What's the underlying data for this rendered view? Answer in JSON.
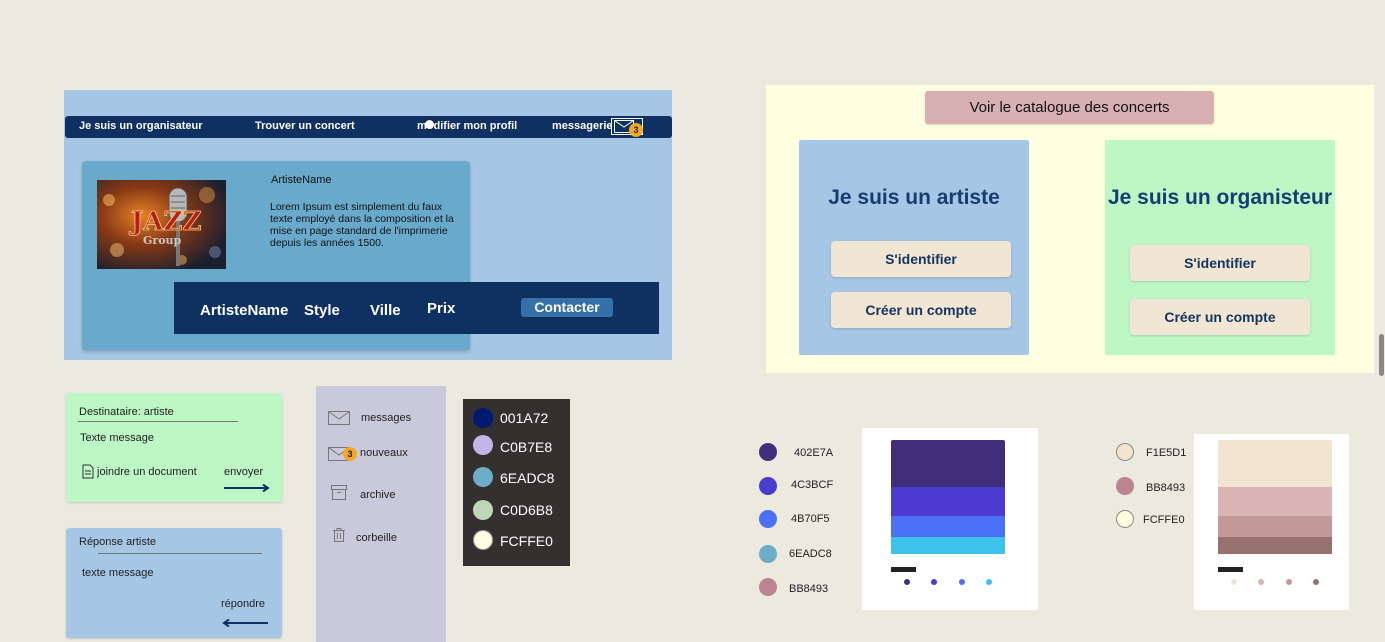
{
  "nav": {
    "organizer": "Je suis un organisateur",
    "find_concert": "Trouver un concert",
    "edit_profile": "modifier mon profil",
    "messaging": "messagerie",
    "badge_count": "3"
  },
  "artist_card": {
    "name": "ArtisteName",
    "description": "Lorem Ipsum est simplement du faux texte employé dans la  composition et la mise en page standard de l'imprimerie depuis les années 1500.",
    "image_text_main": "JAZZ",
    "image_text_sub": "Group",
    "info": {
      "name": "ArtisteName",
      "style": "Style",
      "city": "Ville",
      "price": "Prix",
      "contact": "Contacter"
    }
  },
  "home": {
    "catalogue": "Voir le catalogue des concerts",
    "artist_title": "Je suis un artiste",
    "artist_login": "S'identifier",
    "artist_signup": "Créer un compte",
    "organizer_title": "Je suis un organisteur",
    "organizer_login": "S'identifier",
    "organizer_signup": "Créer un compte"
  },
  "compose": {
    "recipient": "Destinataire: artiste",
    "message": "Texte message",
    "attach": "joindre un document",
    "send": "envoyer"
  },
  "reply": {
    "title": "Réponse artiste",
    "message": "texte message",
    "reply": "répondre"
  },
  "mail_sidebar": {
    "messages": "messages",
    "new": "nouveaux",
    "new_count": "3",
    "archive": "archive",
    "trash": "corbeille"
  },
  "dark_palette": [
    {
      "label": "001A72",
      "color": "#001A72"
    },
    {
      "label": "C0B7E8",
      "color": "#C0B7E8"
    },
    {
      "label": "6EADC8",
      "color": "#6EADC8"
    },
    {
      "label": "C0D6B8",
      "color": "#C0D6B8"
    },
    {
      "label": "FCFFE0",
      "color": "#FCFFE0"
    }
  ],
  "palette_a": [
    {
      "label": "402E7A",
      "color": "#402E7A"
    },
    {
      "label": "4C3BCF",
      "color": "#4C3BCF"
    },
    {
      "label": "4B70F5",
      "color": "#4B70F5"
    },
    {
      "label": "6EADC8",
      "color": "#6EADC8"
    },
    {
      "label": "BB8493",
      "color": "#BB8493"
    }
  ],
  "palette_b": [
    {
      "label": "F1E5D1",
      "color": "#F1E5D1"
    },
    {
      "label": "BB8493",
      "color": "#BB8493"
    },
    {
      "label": "FCFFE0",
      "color": "#FCFFE0"
    }
  ],
  "palette_a_image": {
    "bands": [
      "#402E7A",
      "#4C3BCF",
      "#4B70F5",
      "#3DC2EC"
    ],
    "dots": [
      "#402E7A",
      "#4C3BCF",
      "#4B70F5",
      "#3DC2EC"
    ]
  },
  "palette_b_image": {
    "bands": [
      "#F1E5D1",
      "#DBB5B5",
      "#C39898",
      "#987070"
    ],
    "dots": [
      "#F1E5D1",
      "#DBB5B5",
      "#C39898",
      "#987070"
    ]
  },
  "colors": {
    "navy": "#0F3162",
    "frame_blue": "#A6C6E6",
    "card_blue": "#69A9CB",
    "mint": "#BDF7C6",
    "cream": "#FDFFE1",
    "badge": "#F4A91F"
  },
  "icons": [
    "mail-icon",
    "document-icon",
    "archive-icon",
    "trash-icon",
    "arrow-right-icon",
    "arrow-left-icon",
    "toggle-icon"
  ]
}
